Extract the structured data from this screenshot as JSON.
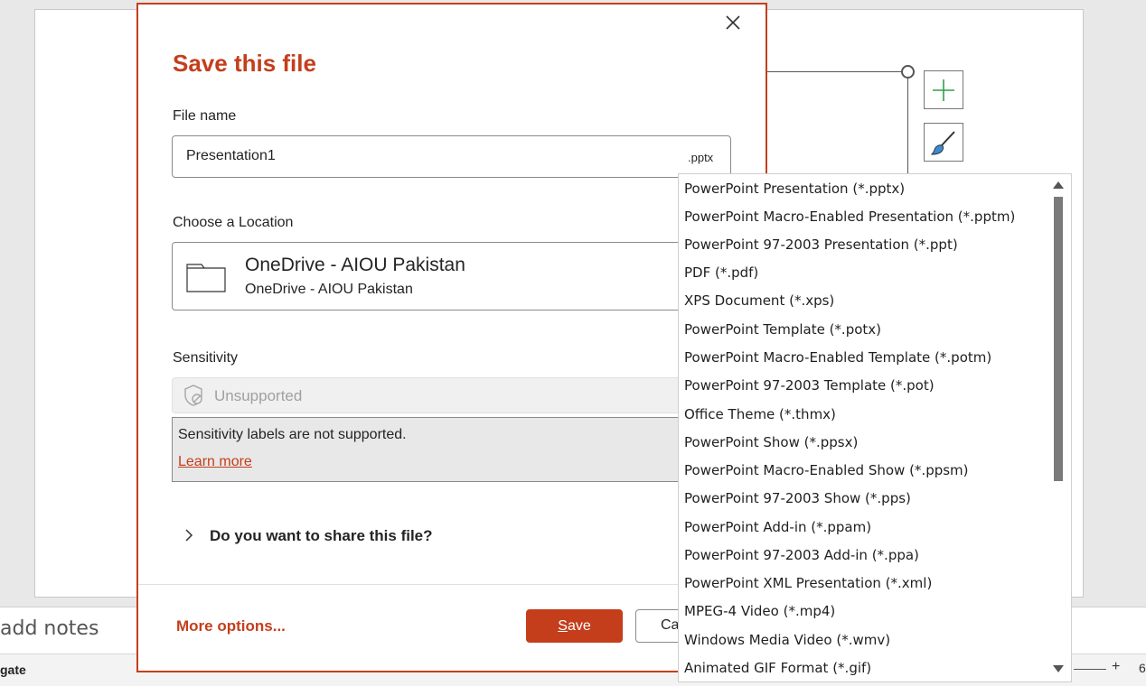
{
  "background": {
    "notes_placeholder": "add notes",
    "status_left": "gate",
    "zoom_plus": "+",
    "zoom_value": "6"
  },
  "dialog": {
    "title": "Save this file",
    "file_name_label": "File name",
    "file_name_value": "Presentation1",
    "file_extension": ".pptx",
    "location_label": "Choose a Location",
    "location_title": "OneDrive - AIOU Pakistan",
    "location_subtitle": "OneDrive - AIOU Pakistan",
    "sensitivity_label": "Sensitivity",
    "sensitivity_value": "Unsupported",
    "sensitivity_info": "Sensitivity labels are not supported.",
    "learn_more": "Learn more",
    "share_question": "Do you want to share this file?",
    "more_options": "More options...",
    "save_label_key": "S",
    "save_label_rest": "ave",
    "cancel_label": "Ca"
  },
  "file_types": [
    "PowerPoint Presentation (*.pptx)",
    "PowerPoint Macro-Enabled Presentation (*.pptm)",
    "PowerPoint 97-2003 Presentation (*.ppt)",
    "PDF (*.pdf)",
    "XPS Document (*.xps)",
    "PowerPoint Template (*.potx)",
    "PowerPoint Macro-Enabled Template (*.potm)",
    "PowerPoint 97-2003 Template (*.pot)",
    "Office Theme (*.thmx)",
    "PowerPoint Show (*.ppsx)",
    "PowerPoint Macro-Enabled Show (*.ppsm)",
    "PowerPoint 97-2003 Show (*.pps)",
    "PowerPoint Add-in (*.ppam)",
    "PowerPoint 97-2003 Add-in (*.ppa)",
    "PowerPoint XML Presentation (*.xml)",
    "MPEG-4 Video (*.mp4)",
    "Windows Media Video (*.wmv)",
    "Animated GIF Format (*.gif)"
  ],
  "icons": {
    "close": "close-icon",
    "folder": "folder-icon",
    "sensitivity": "shield-slash-icon",
    "chevron": "chevron-right-icon",
    "add": "plus-icon",
    "brush": "brush-icon"
  },
  "colors": {
    "accent": "#c43e1c"
  }
}
